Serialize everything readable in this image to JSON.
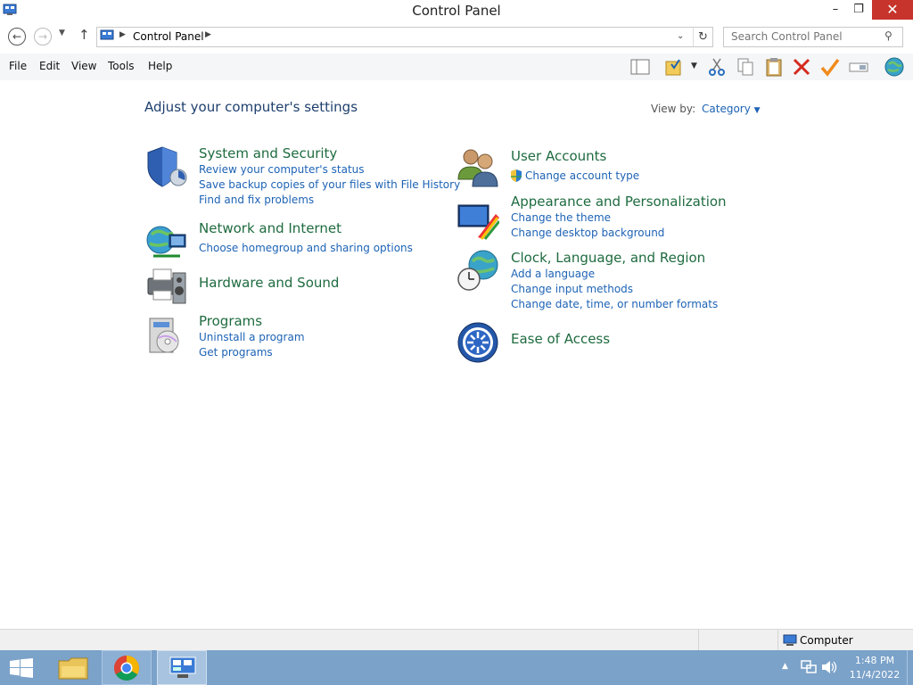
{
  "window": {
    "title": "Control Panel",
    "minimize": "–",
    "restore": "❐",
    "close": "✕"
  },
  "address": {
    "breadcrumb": "Control Panel",
    "search_placeholder": "Search Control Panel"
  },
  "menu": {
    "items": [
      "File",
      "Edit",
      "View",
      "Tools",
      "Help"
    ]
  },
  "content": {
    "heading": "Adjust your computer's settings",
    "view_by_label": "View by:",
    "view_by_value": "Category",
    "left": [
      {
        "title": "System and Security",
        "icon": "shield-icon",
        "links": [
          "Review your computer's status",
          "Save backup copies of your files with File History",
          "Find and fix problems"
        ]
      },
      {
        "title": "Network and Internet",
        "icon": "network-icon",
        "links": [
          "Choose homegroup and sharing options"
        ]
      },
      {
        "title": "Hardware and Sound",
        "icon": "printer-icon",
        "links": []
      },
      {
        "title": "Programs",
        "icon": "programs-icon",
        "links": [
          "Uninstall a program",
          "Get programs"
        ]
      }
    ],
    "right": [
      {
        "title": "User Accounts",
        "icon": "users-icon",
        "links": [
          "Change account type"
        ]
      },
      {
        "title": "Appearance and Personalization",
        "icon": "appearance-icon",
        "links": [
          "Change the theme",
          "Change desktop background"
        ]
      },
      {
        "title": "Clock, Language, and Region",
        "icon": "clock-globe-icon",
        "links": [
          "Add a language",
          "Change input methods",
          "Change date, time, or number formats"
        ]
      },
      {
        "title": "Ease of Access",
        "icon": "ease-of-access-icon",
        "links": []
      }
    ]
  },
  "statusbar": {
    "location": "Computer"
  },
  "taskbar": {
    "time": "1:48 PM",
    "date": "11/4/2022"
  },
  "colors": {
    "link": "#1d63b5",
    "category_title": "#1e6b3f",
    "heading": "#1e3f6e",
    "taskbar": "#7ba2c9",
    "close_button": "#c7342c"
  }
}
